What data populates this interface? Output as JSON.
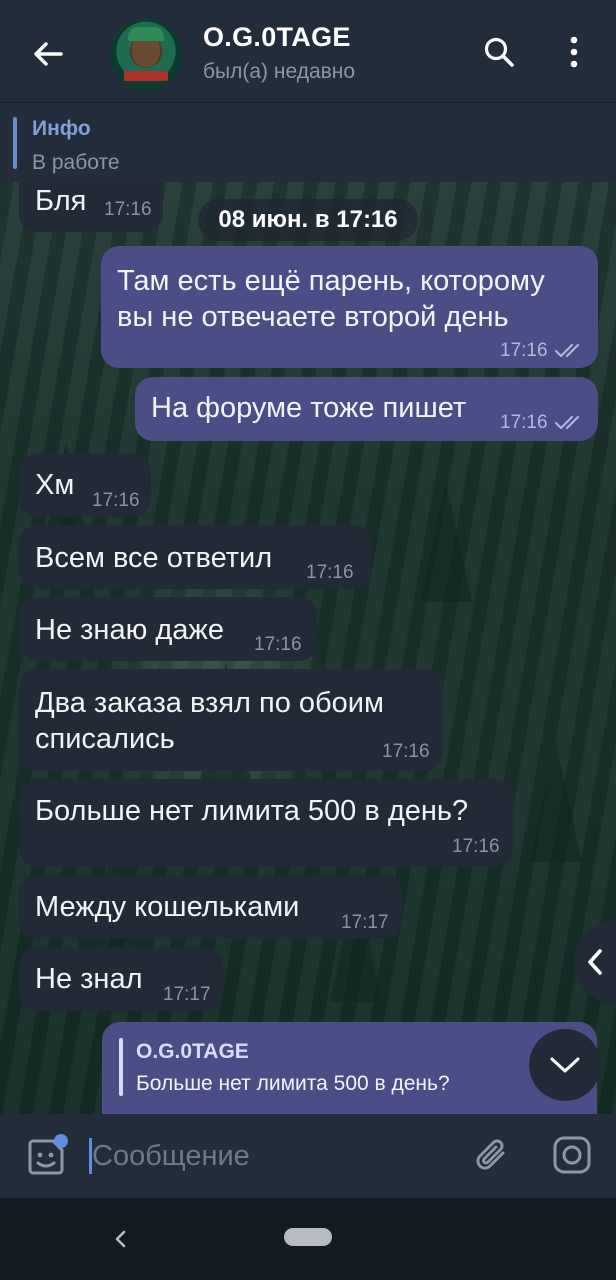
{
  "header": {
    "title": "O.G.0TAGE",
    "status": "был(а) недавно"
  },
  "pinned": {
    "title": "Инфо",
    "text": "В работе"
  },
  "date_pill": "08 июн. в 17:16",
  "messages": [
    {
      "dir": "in",
      "text": "Бля",
      "time": "17:16"
    },
    {
      "dir": "out",
      "lines": [
        "Там есть ещё парень, которому",
        "вы не отвечаете второй день"
      ],
      "time": "17:16"
    },
    {
      "dir": "out",
      "text": "На форуме тоже пишет",
      "time": "17:16"
    },
    {
      "dir": "in",
      "text": "Хм",
      "time": "17:16"
    },
    {
      "dir": "in",
      "text": "Всем все ответил",
      "time": "17:16"
    },
    {
      "dir": "in",
      "text": "Не знаю даже",
      "time": "17:16"
    },
    {
      "dir": "in",
      "lines": [
        "Два заказа взял по обоим",
        "списались"
      ],
      "time": "17:16"
    },
    {
      "dir": "in",
      "text": "Больше нет лимита 500 в день?",
      "time": "17:16"
    },
    {
      "dir": "in",
      "text": "Между кошельками",
      "time": "17:17"
    },
    {
      "dir": "in",
      "text": "Не знал",
      "time": "17:17"
    }
  ],
  "reply_preview": {
    "name": "O.G.0TAGE",
    "text": "Больше нет лимита 500 в день?"
  },
  "input": {
    "placeholder": "Сообщение"
  },
  "icons": [
    "back-arrow-icon",
    "search-icon",
    "more-vert-icon",
    "emoji-icon",
    "attach-icon",
    "camera-icon",
    "chevron-down-icon",
    "chevron-left-icon"
  ],
  "colors": {
    "header_bg": "#222c3b",
    "outgoing_bubble": "#4b4e86",
    "incoming_bubble": "#222a37",
    "accent": "#5d8ee0"
  }
}
